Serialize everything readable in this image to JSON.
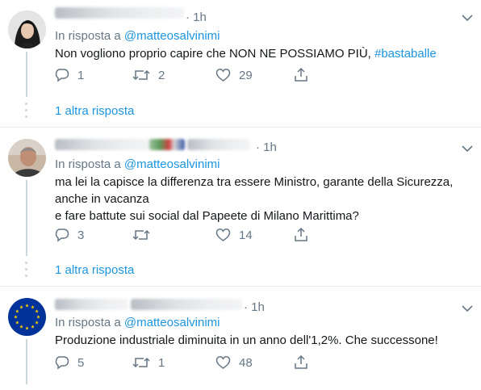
{
  "tweets": [
    {
      "time": "· 1h",
      "reply_prefix": "In risposta a",
      "reply_handle": "@matteosalvinimi",
      "body_line1": "Non vogliono proprio capire che NON NE POSSIAMO PIÙ, ",
      "hashtag": "#bastaballe",
      "replies": "1",
      "retweets": "2",
      "likes": "29",
      "more_replies": "1 altra risposta"
    },
    {
      "time": "· 1h",
      "reply_prefix": "In risposta a",
      "reply_handle": "@matteosalvinimi",
      "body_line1": "ma lei la capisce la differenza tra essere Ministro, garante della Sicurezza,",
      "body_line2": "anche in vacanza",
      "body_line3": "e fare battute sui social dal Papeete di Milano Marittima?",
      "replies": "3",
      "retweets": "",
      "likes": "14",
      "more_replies": "1 altra risposta"
    },
    {
      "time": "· 1h",
      "reply_prefix": "In risposta a",
      "reply_handle": "@matteosalvinimi",
      "body_line1": "Produzione industriale diminuita in un anno dell'1,2%. Che successone!",
      "replies": "5",
      "retweets": "1",
      "likes": "48"
    }
  ],
  "colors": {
    "accent": "#1b95e0",
    "muted": "#657786",
    "text": "#14171a",
    "divider": "#e6ecf0"
  }
}
